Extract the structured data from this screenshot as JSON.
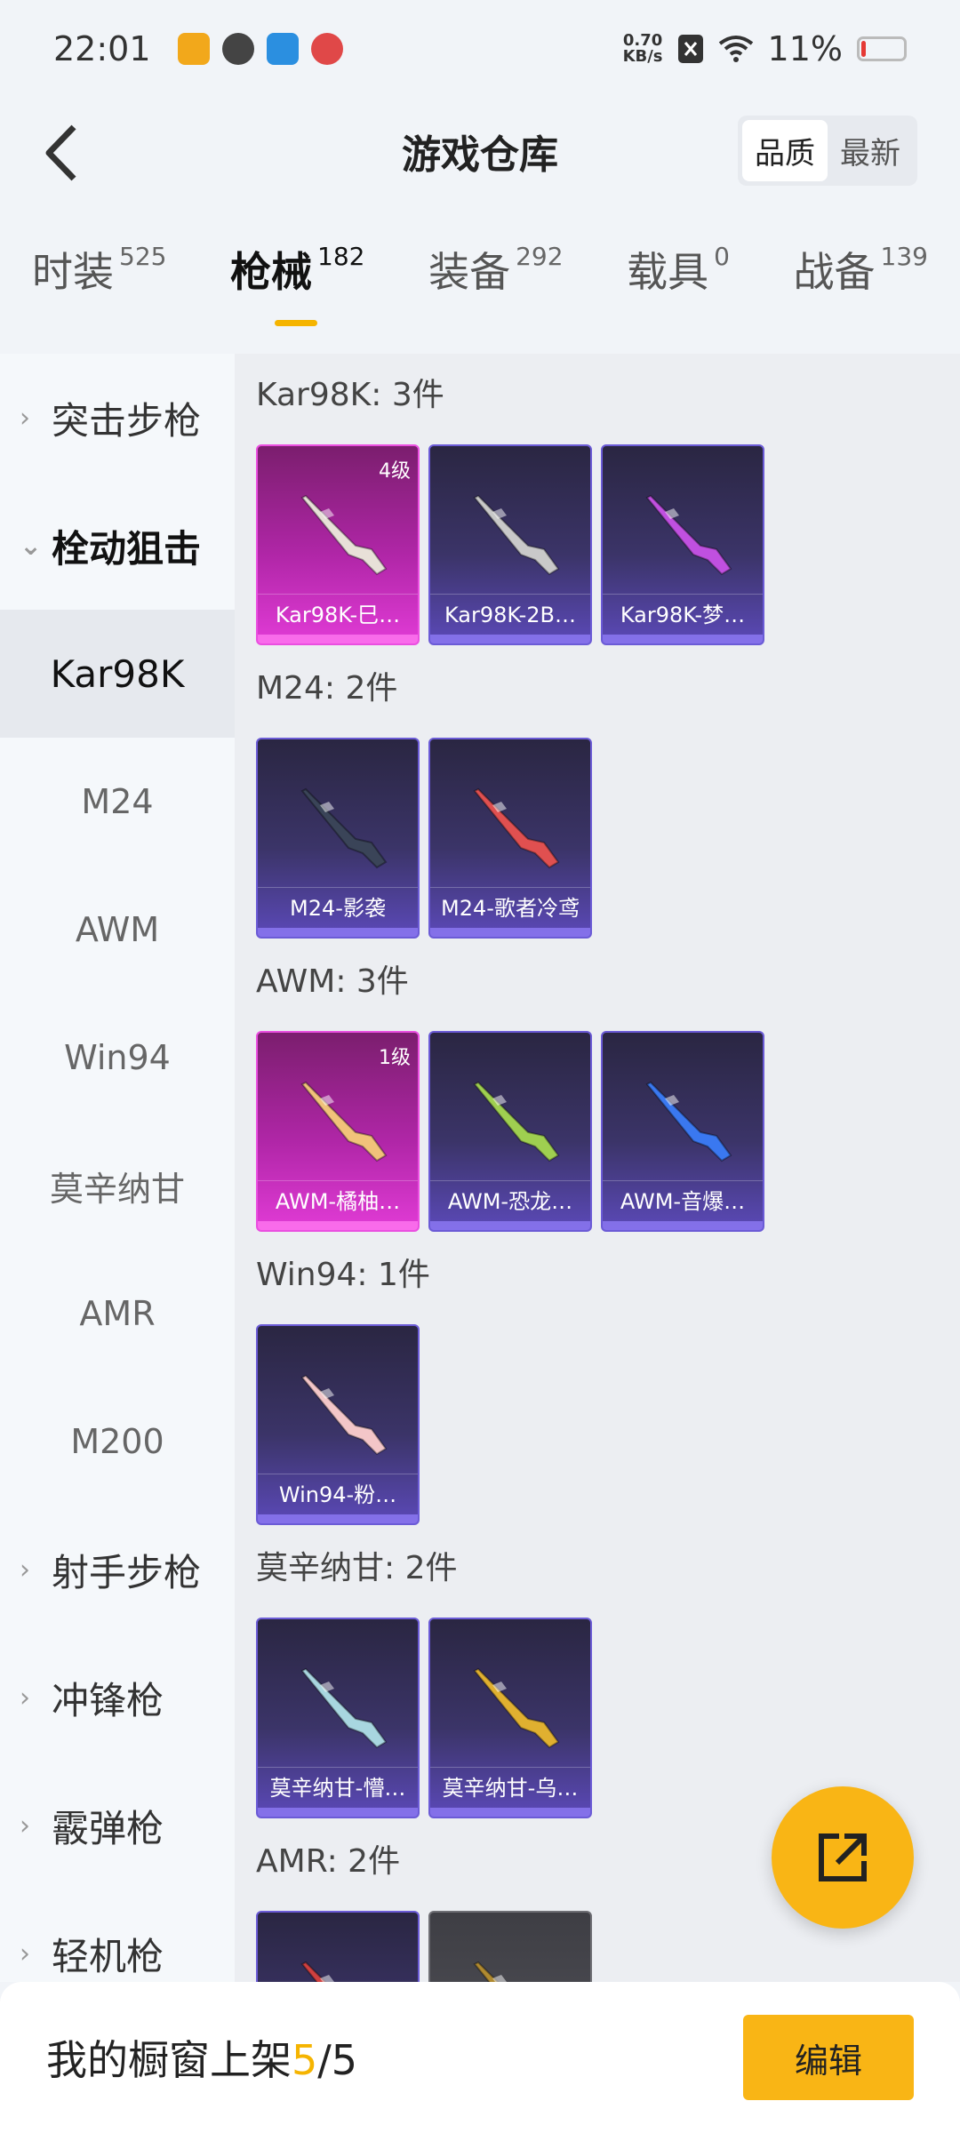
{
  "status_bar": {
    "time": "22:01",
    "net_speed_value": "0.70",
    "net_speed_unit": "KB/s",
    "battery": "11%",
    "battery_level": 0.11,
    "icons": [
      "app-icon-1",
      "app-icon-2",
      "app-icon-3",
      "app-icon-4",
      "notification-muted-icon",
      "wifi-icon",
      "battery-icon"
    ]
  },
  "header": {
    "title": "游戏仓库",
    "sort_options": [
      {
        "label": "品质",
        "active": true
      },
      {
        "label": "最新",
        "active": false
      }
    ]
  },
  "tabs": [
    {
      "label": "时装",
      "count": "525",
      "active": false
    },
    {
      "label": "枪械",
      "count": "182",
      "active": true
    },
    {
      "label": "装备",
      "count": "292",
      "active": false
    },
    {
      "label": "载具",
      "count": "0",
      "active": false
    },
    {
      "label": "战备",
      "count": "139",
      "active": false
    }
  ],
  "sidebar": {
    "items": [
      {
        "label": "突击步枪",
        "type": "group",
        "open": false
      },
      {
        "label": "栓动狙击",
        "type": "group",
        "open": true
      },
      {
        "label": "Kar98K",
        "type": "sub",
        "active": true
      },
      {
        "label": "M24",
        "type": "sub",
        "active": false
      },
      {
        "label": "AWM",
        "type": "sub",
        "active": false
      },
      {
        "label": "Win94",
        "type": "sub",
        "active": false
      },
      {
        "label": "莫辛纳甘",
        "type": "sub",
        "active": false
      },
      {
        "label": "AMR",
        "type": "sub",
        "active": false
      },
      {
        "label": "M200",
        "type": "sub",
        "active": false
      },
      {
        "label": "射手步枪",
        "type": "group",
        "open": false
      },
      {
        "label": "冲锋枪",
        "type": "group",
        "open": false
      },
      {
        "label": "霰弹枪",
        "type": "group",
        "open": false
      },
      {
        "label": "轻机枪",
        "type": "group",
        "open": false
      }
    ]
  },
  "sections": [
    {
      "title": "Kar98K: 3件",
      "cards": [
        {
          "name": "Kar98K-巳…",
          "level": "4级",
          "style": "pink",
          "gun_color": "#e8e0d8"
        },
        {
          "name": "Kar98K-2B…",
          "level": "",
          "style": "purple",
          "gun_color": "#c9c9c9"
        },
        {
          "name": "Kar98K-梦…",
          "level": "",
          "style": "purple",
          "gun_color": "#c050e0"
        }
      ]
    },
    {
      "title": "M24: 2件",
      "cards": [
        {
          "name": "M24-影袭",
          "level": "",
          "style": "purple",
          "gun_color": "#3a4458"
        },
        {
          "name": "M24-歌者冷鸢",
          "level": "",
          "style": "purple",
          "gun_color": "#e05050"
        }
      ]
    },
    {
      "title": "AWM: 3件",
      "cards": [
        {
          "name": "AWM-橘柚…",
          "level": "1级",
          "style": "pink",
          "gun_color": "#f1c27a"
        },
        {
          "name": "AWM-恐龙…",
          "level": "",
          "style": "purple",
          "gun_color": "#9fcf50"
        },
        {
          "name": "AWM-音爆…",
          "level": "",
          "style": "purple",
          "gun_color": "#3a78f0"
        }
      ]
    },
    {
      "title": "Win94: 1件",
      "cards": [
        {
          "name": "Win94-粉…",
          "level": "",
          "style": "purple",
          "gun_color": "#f3c6c8"
        }
      ]
    },
    {
      "title": "莫辛纳甘: 2件",
      "cards": [
        {
          "name": "莫辛纳甘-懵…",
          "level": "",
          "style": "purple",
          "gun_color": "#a8d6e0"
        },
        {
          "name": "莫辛纳甘-乌…",
          "level": "",
          "style": "purple",
          "gun_color": "#e0b030"
        }
      ]
    },
    {
      "title": "AMR: 2件",
      "cards": [
        {
          "name": "",
          "level": "",
          "style": "purple",
          "gun_color": "#d04040"
        },
        {
          "name": "",
          "level": "",
          "style": "grey",
          "gun_color": "#b08a30"
        }
      ]
    }
  ],
  "bottom_bar": {
    "showcase_label": "我的橱窗上架",
    "showcase_current": "5",
    "showcase_total": "/5",
    "edit_label": "编辑"
  },
  "colors": {
    "accent": "#f9b515",
    "card_purple": "#5b49b8",
    "card_pink": "#e13bd6"
  }
}
